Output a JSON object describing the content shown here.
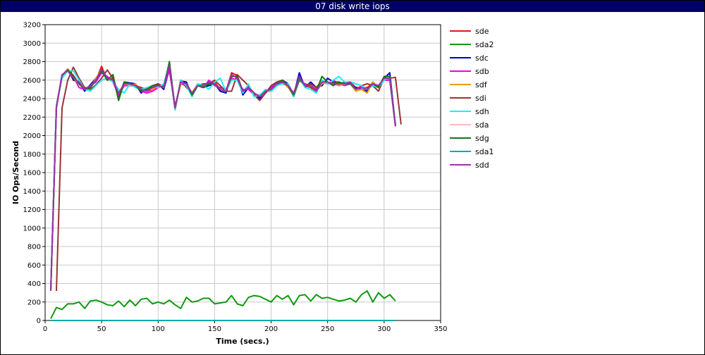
{
  "chart_data": {
    "type": "line",
    "title": "07 disk write iops",
    "xlabel": "Time (secs.)",
    "ylabel": "IO Ops/Second",
    "xlim": [
      0,
      350
    ],
    "ylim": [
      0,
      3200
    ],
    "xticks": [
      0,
      50,
      100,
      150,
      200,
      250,
      300,
      350
    ],
    "yticks": [
      0,
      200,
      400,
      600,
      800,
      1000,
      1200,
      1400,
      1600,
      1800,
      2000,
      2200,
      2400,
      2600,
      2800,
      3000,
      3200
    ],
    "grid": true,
    "legend": "right",
    "series": [
      {
        "name": "sde",
        "color": "#ee1111",
        "x": [
          5,
          10,
          15,
          20,
          25,
          30,
          35,
          40,
          45,
          50,
          55,
          60,
          65,
          70,
          75,
          80,
          85,
          90,
          95,
          100,
          105,
          110,
          115,
          120,
          125,
          130,
          135,
          140,
          145,
          150,
          155,
          160,
          165,
          170,
          175,
          180,
          185,
          190,
          195,
          200,
          205,
          210,
          215,
          220,
          225,
          230,
          235,
          240,
          245,
          250,
          255,
          260,
          265,
          270,
          275,
          280,
          285,
          290,
          295,
          300,
          305,
          310
        ],
        "y": [
          320,
          2300,
          2650,
          2720,
          2650,
          2560,
          2500,
          2520,
          2600,
          2750,
          2600,
          2620,
          2450,
          2560,
          2550,
          2530,
          2500,
          2480,
          2500,
          2540,
          2520,
          2780,
          2280,
          2600,
          2560,
          2450,
          2560,
          2540,
          2560,
          2580,
          2500,
          2480,
          2680,
          2650,
          2480,
          2530,
          2460,
          2420,
          2480,
          2500,
          2560,
          2600,
          2540,
          2450,
          2640,
          2540,
          2520,
          2480,
          2560,
          2580,
          2560,
          2540,
          2560,
          2580,
          2520,
          2520,
          2520,
          2560,
          2540,
          2600,
          2600,
          2100
        ]
      },
      {
        "name": "sda2",
        "color": "#119911",
        "x": [
          5,
          10,
          15,
          20,
          25,
          30,
          35,
          40,
          45,
          50,
          55,
          60,
          65,
          70,
          75,
          80,
          85,
          90,
          95,
          100,
          105,
          110,
          115,
          120,
          125,
          130,
          135,
          140,
          145,
          150,
          155,
          160,
          165,
          170,
          175,
          180,
          185,
          190,
          195,
          200,
          205,
          210,
          215,
          220,
          225,
          230,
          235,
          240,
          245,
          250,
          255,
          260,
          265,
          270,
          275,
          280,
          285,
          290,
          295,
          300,
          305,
          310
        ],
        "y": [
          20,
          140,
          120,
          180,
          180,
          200,
          130,
          210,
          220,
          200,
          170,
          160,
          210,
          150,
          220,
          160,
          230,
          240,
          180,
          200,
          180,
          220,
          170,
          130,
          250,
          200,
          210,
          240,
          240,
          180,
          190,
          200,
          270,
          180,
          160,
          250,
          270,
          260,
          230,
          200,
          270,
          230,
          270,
          170,
          270,
          280,
          210,
          280,
          240,
          250,
          230,
          210,
          220,
          240,
          200,
          280,
          320,
          200,
          300,
          240,
          280,
          210
        ]
      },
      {
        "name": "sdc",
        "color": "#0000cc",
        "x": [
          5,
          10,
          15,
          20,
          25,
          30,
          35,
          40,
          45,
          50,
          55,
          60,
          65,
          70,
          75,
          80,
          85,
          90,
          95,
          100,
          105,
          110,
          115,
          120,
          125,
          130,
          135,
          140,
          145,
          150,
          155,
          160,
          165,
          170,
          175,
          180,
          185,
          190,
          195,
          200,
          205,
          210,
          215,
          220,
          225,
          230,
          235,
          240,
          245,
          250,
          255,
          260,
          265,
          270,
          275,
          280,
          285,
          290,
          295,
          300,
          305,
          310
        ],
        "y": [
          330,
          2320,
          2640,
          2720,
          2600,
          2580,
          2480,
          2550,
          2620,
          2700,
          2620,
          2600,
          2420,
          2580,
          2570,
          2560,
          2460,
          2520,
          2520,
          2560,
          2500,
          2720,
          2300,
          2590,
          2580,
          2430,
          2540,
          2520,
          2540,
          2560,
          2480,
          2460,
          2640,
          2640,
          2440,
          2520,
          2460,
          2400,
          2500,
          2480,
          2540,
          2600,
          2560,
          2440,
          2680,
          2520,
          2580,
          2520,
          2540,
          2620,
          2580,
          2540,
          2580,
          2560,
          2520,
          2500,
          2480,
          2580,
          2520,
          2620,
          2680,
          2110
        ]
      },
      {
        "name": "sdb",
        "color": "#ee00ee",
        "x": [
          5,
          10,
          15,
          20,
          25,
          30,
          35,
          40,
          45,
          50,
          55,
          60,
          65,
          70,
          75,
          80,
          85,
          90,
          95,
          100,
          105,
          110,
          115,
          120,
          125,
          130,
          135,
          140,
          145,
          150,
          155,
          160,
          165,
          170,
          175,
          180,
          185,
          190,
          195,
          200,
          205,
          210,
          215,
          220,
          225,
          230,
          235,
          240,
          245,
          250,
          255,
          260,
          265,
          270,
          275,
          280,
          285,
          290,
          295,
          300,
          305,
          310
        ],
        "y": [
          340,
          2310,
          2660,
          2700,
          2640,
          2520,
          2500,
          2540,
          2580,
          2680,
          2640,
          2580,
          2440,
          2540,
          2540,
          2540,
          2480,
          2460,
          2480,
          2520,
          2540,
          2700,
          2320,
          2560,
          2540,
          2460,
          2560,
          2520,
          2600,
          2540,
          2520,
          2500,
          2620,
          2600,
          2500,
          2500,
          2440,
          2440,
          2460,
          2520,
          2580,
          2560,
          2540,
          2460,
          2600,
          2560,
          2540,
          2500,
          2580,
          2560,
          2600,
          2560,
          2540,
          2560,
          2500,
          2540,
          2500,
          2560,
          2540,
          2600,
          2600,
          2120
        ]
      },
      {
        "name": "sdf",
        "color": "#ee9900",
        "x": [
          5,
          10,
          15,
          20,
          25,
          30,
          35,
          40,
          45,
          50,
          55,
          60,
          65,
          70,
          75,
          80,
          85,
          90,
          95,
          100,
          105,
          110,
          115,
          120,
          125,
          130,
          135,
          140,
          145,
          150,
          155,
          160,
          165,
          170,
          175,
          180,
          185,
          190,
          195,
          200,
          205,
          210,
          215,
          220,
          225,
          230,
          235,
          240,
          245,
          250,
          255,
          260,
          265,
          270,
          275,
          280,
          285,
          290,
          295,
          300,
          305,
          310
        ],
        "y": [
          320,
          2300,
          2640,
          2720,
          2620,
          2560,
          2520,
          2520,
          2620,
          2720,
          2600,
          2600,
          2460,
          2560,
          2540,
          2560,
          2480,
          2500,
          2500,
          2540,
          2520,
          2760,
          2300,
          2560,
          2560,
          2460,
          2560,
          2540,
          2560,
          2560,
          2500,
          2480,
          2660,
          2620,
          2480,
          2520,
          2460,
          2420,
          2480,
          2480,
          2560,
          2580,
          2520,
          2460,
          2620,
          2540,
          2540,
          2480,
          2560,
          2580,
          2560,
          2540,
          2560,
          2560,
          2480,
          2500,
          2460,
          2580,
          2520,
          2620,
          2620,
          2100
        ]
      },
      {
        "name": "sdi",
        "color": "#993333",
        "x": [
          10,
          15,
          20,
          25,
          30,
          35,
          40,
          45,
          50,
          55,
          60,
          65,
          70,
          75,
          80,
          85,
          90,
          95,
          100,
          105,
          110,
          115,
          120,
          125,
          130,
          135,
          140,
          145,
          150,
          155,
          160,
          165,
          170,
          175,
          180,
          185,
          190,
          195,
          200,
          205,
          210,
          215,
          220,
          225,
          230,
          235,
          240,
          245,
          250,
          255,
          260,
          265,
          270,
          275,
          280,
          285,
          290,
          295,
          300,
          305,
          310,
          315
        ],
        "y": [
          320,
          2300,
          2600,
          2740,
          2620,
          2520,
          2500,
          2550,
          2620,
          2710,
          2620,
          2400,
          2580,
          2560,
          2540,
          2520,
          2500,
          2540,
          2560,
          2530,
          2740,
          2280,
          2600,
          2520,
          2460,
          2540,
          2560,
          2560,
          2600,
          2540,
          2480,
          2480,
          2660,
          2600,
          2540,
          2440,
          2380,
          2460,
          2540,
          2580,
          2600,
          2540,
          2420,
          2600,
          2540,
          2560,
          2520,
          2600,
          2560,
          2580,
          2580,
          2560,
          2580,
          2560,
          2540,
          2560,
          2540,
          2480,
          2620,
          2620,
          2630,
          2120
        ]
      },
      {
        "name": "sdh",
        "color": "#22eeee",
        "x": [
          5,
          10,
          15,
          20,
          25,
          30,
          35,
          40,
          45,
          50,
          55,
          60,
          65,
          70,
          75,
          80,
          85,
          90,
          95,
          100,
          105,
          110,
          115,
          120,
          125,
          130,
          135,
          140,
          145,
          150,
          155,
          160,
          165,
          170,
          175,
          180,
          185,
          190,
          195,
          200,
          205,
          210,
          215,
          220,
          225,
          230,
          235,
          240,
          245,
          250,
          255,
          260,
          265,
          270,
          275,
          280,
          285,
          290,
          295,
          300,
          305,
          310
        ],
        "y": [
          330,
          2320,
          2620,
          2700,
          2700,
          2600,
          2500,
          2480,
          2540,
          2600,
          2620,
          2580,
          2500,
          2460,
          2560,
          2520,
          2500,
          2520,
          2540,
          2520,
          2560,
          2780,
          2280,
          2600,
          2540,
          2420,
          2560,
          2540,
          2500,
          2580,
          2620,
          2480,
          2600,
          2600,
          2460,
          2560,
          2420,
          2440,
          2500,
          2480,
          2540,
          2560,
          2560,
          2420,
          2620,
          2520,
          2500,
          2460,
          2600,
          2560,
          2600,
          2640,
          2580,
          2580,
          2560,
          2540,
          2500,
          2540,
          2520,
          2600,
          2640,
          2120
        ]
      },
      {
        "name": "sda",
        "color": "#ffbbbb",
        "x": [
          5,
          310
        ],
        "y": [
          0,
          0
        ]
      },
      {
        "name": "sdg",
        "color": "#117711",
        "x": [
          5,
          10,
          15,
          20,
          25,
          30,
          35,
          40,
          45,
          50,
          55,
          60,
          65,
          70,
          75,
          80,
          85,
          90,
          95,
          100,
          105,
          110,
          115,
          120,
          125,
          130,
          135,
          140,
          145,
          150,
          155,
          160,
          165,
          170,
          175,
          180,
          185,
          190,
          195,
          200,
          205,
          210,
          215,
          220,
          225,
          230,
          235,
          240,
          245,
          250,
          255,
          260,
          265,
          270,
          275,
          280,
          285,
          290,
          295,
          300,
          305,
          310
        ],
        "y": [
          330,
          2310,
          2650,
          2710,
          2640,
          2560,
          2500,
          2520,
          2600,
          2700,
          2600,
          2660,
          2380,
          2580,
          2560,
          2540,
          2480,
          2500,
          2540,
          2540,
          2520,
          2800,
          2300,
          2580,
          2560,
          2440,
          2540,
          2520,
          2560,
          2560,
          2500,
          2480,
          2640,
          2640,
          2480,
          2520,
          2460,
          2420,
          2480,
          2500,
          2560,
          2600,
          2540,
          2440,
          2620,
          2540,
          2540,
          2480,
          2640,
          2580,
          2540,
          2580,
          2560,
          2560,
          2500,
          2520,
          2500,
          2560,
          2520,
          2640,
          2640,
          2110
        ]
      },
      {
        "name": "sda1",
        "color": "#00aaaa",
        "x": [
          5,
          310
        ],
        "y": [
          0,
          0
        ]
      },
      {
        "name": "sdd",
        "color": "#9933aa",
        "x": [
          5,
          10,
          15,
          20,
          25,
          30,
          35,
          40,
          45,
          50,
          55,
          60,
          65,
          70,
          75,
          80,
          85,
          90,
          95,
          100,
          105,
          110,
          115,
          120,
          125,
          130,
          135,
          140,
          145,
          150,
          155,
          160,
          165,
          170,
          175,
          180,
          185,
          190,
          195,
          200,
          205,
          210,
          215,
          220,
          225,
          230,
          235,
          240,
          245,
          250,
          255,
          260,
          265,
          270,
          275,
          280,
          285,
          290,
          295,
          300,
          305,
          310
        ],
        "y": [
          320,
          2300,
          2660,
          2700,
          2620,
          2580,
          2500,
          2540,
          2600,
          2720,
          2620,
          2600,
          2460,
          2560,
          2560,
          2540,
          2500,
          2480,
          2520,
          2540,
          2520,
          2760,
          2300,
          2580,
          2560,
          2460,
          2540,
          2540,
          2580,
          2560,
          2500,
          2480,
          2660,
          2620,
          2480,
          2520,
          2460,
          2420,
          2480,
          2500,
          2560,
          2580,
          2540,
          2460,
          2640,
          2540,
          2540,
          2480,
          2580,
          2580,
          2560,
          2560,
          2560,
          2580,
          2500,
          2520,
          2500,
          2560,
          2540,
          2620,
          2620,
          2100
        ]
      }
    ]
  }
}
